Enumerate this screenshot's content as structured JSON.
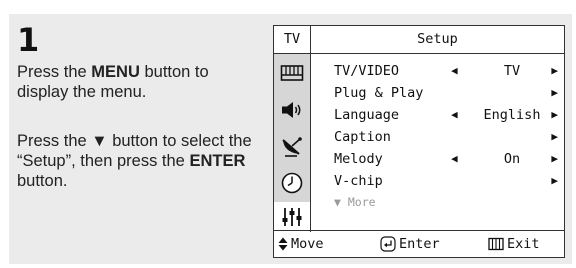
{
  "step": {
    "number": "1"
  },
  "instructions": {
    "p1_before": "Press the ",
    "p1_bold": "MENU",
    "p1_after": " button to display the menu.",
    "p2_before": "Press the ▼ button to select the “Setup”, then press the ",
    "p2_bold": "ENTER",
    "p2_after": " button."
  },
  "osd": {
    "source_label": "TV",
    "title": "Setup",
    "sidebar_icons": [
      "picture-icon",
      "sound-icon",
      "channel-antenna-icon",
      "clock-icon",
      "setup-sliders-icon"
    ],
    "items": [
      {
        "name": "TV/VIDEO",
        "value": "TV",
        "left_arrow": "◀",
        "right_arrow": "▶"
      },
      {
        "name": "Plug & Play",
        "value": "",
        "left_arrow": "",
        "right_arrow": "▶"
      },
      {
        "name": "Language",
        "value": "English",
        "left_arrow": "◀",
        "right_arrow": "▶"
      },
      {
        "name": "Caption",
        "value": "",
        "left_arrow": "",
        "right_arrow": "▶"
      },
      {
        "name": "Melody",
        "value": "On",
        "left_arrow": "◀",
        "right_arrow": "▶"
      },
      {
        "name": "V-chip",
        "value": "",
        "left_arrow": "",
        "right_arrow": "▶"
      }
    ],
    "more_label": "▼ More",
    "footer": {
      "move_label": "Move",
      "enter_label": "Enter",
      "exit_label": "Exit"
    }
  }
}
